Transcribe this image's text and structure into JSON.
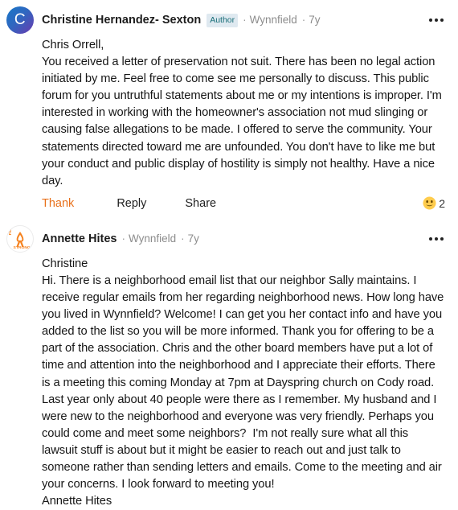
{
  "comments": [
    {
      "avatar_type": "initial",
      "avatar_initial": "C",
      "author": "Christine Hernandez- Sexton",
      "badge": "Author",
      "separator": "·",
      "location": "Wynnfield",
      "time": "7y",
      "body": "Chris Orrell,\nYou received a letter of preservation not suit. There has been no legal action initiated by me. Feel free to come see me personally to discuss. This public forum for you untruthful statements about me or my intentions is improper. I'm interested in working with the homeowner's association not mud slinging or causing false allegations to be made. I offered to serve the community. Your statements directed toward me are unfounded. You don't have to like me but your conduct and public display of hostility is simply not healthy. Have a nice day.",
      "actions": {
        "thank": "Thank",
        "reply": "Reply",
        "share": "Share"
      },
      "reaction": {
        "emoji": "smiley-face-emoji",
        "count": "2"
      },
      "overflow": "more-options-icon"
    },
    {
      "avatar_type": "ribbon",
      "avatar_ribbon_top_text": "FIGHT",
      "avatar_ribbon_bottom_text": "STRONG",
      "author": "Annette Hites",
      "badge": "",
      "separator": "·",
      "location": "Wynnfield",
      "time": "7y",
      "body": "Christine\nHi. There is a neighborhood email list that our neighbor Sally maintains. I receive regular emails from her regarding neighborhood news. How long have you lived in Wynnfield? Welcome! I can get you her contact info and have you added to the list so you will be more informed. Thank you for offering to be a part of the association. Chris and the other board members have put a lot of time and attention into the neighborhood and I appreciate their efforts. There is a meeting this coming Monday at 7pm at Dayspring church on Cody road. Last year only about 40 people were there as I remember. My husband and I were new to the neighborhood and everyone was very friendly. Perhaps you could come and meet some neighbors?  I'm not really sure what all this lawsuit stuff is about but it might be easier to reach out and just talk to someone rather than sending letters and emails. Come to the meeting and air your concerns. I look forward to meeting you!\nAnnette Hites",
      "overflow": "more-options-icon"
    }
  ],
  "colors": {
    "thank_orange": "#e8701a",
    "badge_bg": "#dfe9f0",
    "badge_text": "#186e78",
    "meta_gray": "#8c8c8c",
    "ribbon_orange": "#f5821f",
    "emoji_yellow": "#ffc83d"
  }
}
